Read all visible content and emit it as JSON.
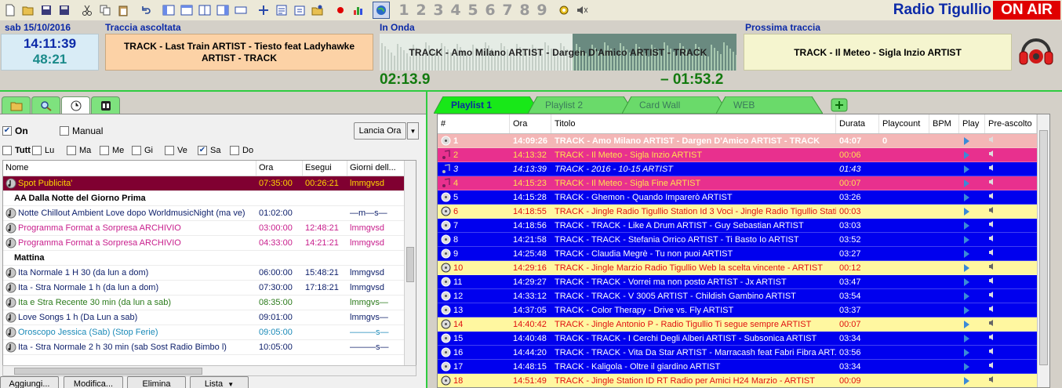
{
  "toolbar": {
    "numbers": [
      "1",
      "2",
      "3",
      "4",
      "5",
      "6",
      "7",
      "8",
      "9"
    ],
    "station": "Radio Tigullio",
    "onair": "ON AIR"
  },
  "status": {
    "date": "sab 15/10/2016",
    "time": "14:11:39",
    "sub_time": "48:21",
    "last_label": "Traccia ascoltata",
    "last_track": "TRACK - Last Train ARTIST - Tiesto feat Ladyhawke ARTIST - TRACK",
    "onda_label": "In Onda",
    "onda_track": "TRACK - Amo Milano ARTIST - Dargen D'Amico  ARTIST - TRACK",
    "elapsed": "02:13.9",
    "remaining": "– 01:53.2",
    "onda_progress": 0.54,
    "next_label": "Prossima traccia",
    "next_track": "TRACK - Il Meteo - Sigla Inzio  ARTIST"
  },
  "left": {
    "on_label": "On",
    "manual_label": "Manual",
    "lancia_label": "Lancia Ora",
    "days": [
      "Tutt",
      "Lu",
      "Ma",
      "Me",
      "Gi",
      "Ve",
      "Sa",
      "Do"
    ],
    "headers": [
      "Nome",
      "Ora",
      "Esegui",
      "Giorni dell..."
    ],
    "rows": [
      {
        "type": "sel",
        "name": "Spot Publicita'",
        "ora": "07:35:00",
        "esegui": "00:26:21",
        "giorni": "lmmgvsd"
      },
      {
        "type": "group",
        "name": "AA Dalla Notte del Giorno Prima",
        "ora": "",
        "esegui": "",
        "giorni": ""
      },
      {
        "type": "navy",
        "name": "Notte Chillout Ambient Love dopo WorldmusicNight  (ma ve)",
        "ora": "01:02:00",
        "esegui": "",
        "giorni": "—m—s—"
      },
      {
        "type": "magenta",
        "name": "Programma Format a Sorpresa ARCHIVIO",
        "ora": "03:00:00",
        "esegui": "12:48:21",
        "giorni": "lmmgvsd"
      },
      {
        "type": "magenta",
        "name": "Programma Format a Sorpresa ARCHIVIO",
        "ora": "04:33:00",
        "esegui": "14:21:21",
        "giorni": "lmmgvsd"
      },
      {
        "type": "group",
        "name": "Mattina",
        "ora": "",
        "esegui": "",
        "giorni": ""
      },
      {
        "type": "navy",
        "name": "Ita  Normale 1 H  30 (da lun a dom)",
        "ora": "06:00:00",
        "esegui": "15:48:21",
        "giorni": "lmmgvsd"
      },
      {
        "type": "navy",
        "name": "Ita - Stra Normale 1 h (da lun a dom)",
        "ora": "07:30:00",
        "esegui": "17:18:21",
        "giorni": "lmmgvsd"
      },
      {
        "type": "green",
        "name": "Ita e Stra Recente  30 min (da lun a sab)",
        "ora": "08:35:00",
        "esegui": "",
        "giorni": "lmmgvs—"
      },
      {
        "type": "navy",
        "name": "Love Songs  1 h (Da Lun a sab)",
        "ora": "09:01:00",
        "esegui": "",
        "giorni": "lmmgvs—"
      },
      {
        "type": "teal",
        "name": "Oroscopo Jessica (Sab) (Stop Ferie)",
        "ora": "09:05:00",
        "esegui": "",
        "giorni": "———s—"
      },
      {
        "type": "navy",
        "name": "Ita - Stra Normale  2 h 30 min  (sab Sost Radio Bimbo l)",
        "ora": "10:05:00",
        "esegui": "",
        "giorni": "———s—"
      }
    ],
    "buttons": [
      "Aggiungi...",
      "Modifica...",
      "Elimina",
      "Lista"
    ]
  },
  "right": {
    "tabs": [
      "Playlist 1",
      "Playlist 2",
      "Card Wall",
      "WEB"
    ],
    "headers": [
      "#",
      "Ora",
      "Titolo",
      "Durata",
      "Playcount",
      "BPM",
      "Play",
      "Pre-ascolto"
    ],
    "rows": [
      {
        "style": "first",
        "num": "1",
        "ora": "14:09:26",
        "titolo": "TRACK - Amo Milano ARTIST - Dargen D'Amico  ARTIST - TRACK",
        "durata": "04:07",
        "pc": "0"
      },
      {
        "style": "pink",
        "num": "2",
        "ora": "14:13:32",
        "titolo": "TRACK - Il Meteo - Sigla Inzio  ARTIST",
        "durata": "00:06",
        "pc": ""
      },
      {
        "style": "blue italic",
        "num": "3",
        "ora": "14:13:39",
        "titolo": "TRACK - 2016 - 10-15  ARTIST",
        "durata": "01:43",
        "pc": ""
      },
      {
        "style": "pink",
        "num": "4",
        "ora": "14:15:23",
        "titolo": "TRACK - Il Meteo - Sigla Fine  ARTIST",
        "durata": "00:07",
        "pc": ""
      },
      {
        "style": "blue",
        "num": "5",
        "ora": "14:15:28",
        "titolo": "TRACK - Ghemon - Quando Imparerò  ARTIST",
        "durata": "03:26",
        "pc": ""
      },
      {
        "style": "yellow",
        "num": "6",
        "ora": "14:18:55",
        "titolo": "TRACK - Jingle Radio Tigullio Station Id 3 Voci - Jingle Radio Tigullio Stati...",
        "durata": "00:03",
        "pc": ""
      },
      {
        "style": "blue",
        "num": "7",
        "ora": "14:18:56",
        "titolo": "TRACK - TRACK - Like A Drum ARTIST - Guy Sebastian  ARTIST",
        "durata": "03:03",
        "pc": ""
      },
      {
        "style": "blue",
        "num": "8",
        "ora": "14:21:58",
        "titolo": "TRACK - TRACK - Stefania Orrico ARTIST - Ti Basto Io  ARTIST",
        "durata": "03:52",
        "pc": ""
      },
      {
        "style": "blue",
        "num": "9",
        "ora": "14:25:48",
        "titolo": "TRACK - Claudia Megrè - Tu non puoi  ARTIST",
        "durata": "03:27",
        "pc": ""
      },
      {
        "style": "yellow",
        "num": "10",
        "ora": "14:29:16",
        "titolo": "TRACK - Jingle Marzio Radio Tigullio Web la scelta vincente -  ARTIST",
        "durata": "00:12",
        "pc": ""
      },
      {
        "style": "blue",
        "num": "11",
        "ora": "14:29:27",
        "titolo": "TRACK - TRACK - Vorrei ma non posto ARTIST - Jx  ARTIST",
        "durata": "03:47",
        "pc": ""
      },
      {
        "style": "blue",
        "num": "12",
        "ora": "14:33:12",
        "titolo": "TRACK - TRACK - V 3005 ARTIST - Childish Gambino  ARTIST",
        "durata": "03:54",
        "pc": ""
      },
      {
        "style": "blue",
        "num": "13",
        "ora": "14:37:05",
        "titolo": "TRACK - Color Therapy - Drive vs. Fly  ARTIST",
        "durata": "03:37",
        "pc": ""
      },
      {
        "style": "yellow",
        "num": "14",
        "ora": "14:40:42",
        "titolo": "TRACK - Jingle Antonio P - Radio Tigullio Ti segue sempre  ARTIST",
        "durata": "00:07",
        "pc": ""
      },
      {
        "style": "blue",
        "num": "15",
        "ora": "14:40:48",
        "titolo": "TRACK - TRACK - I Cerchi Degli Alberi ARTIST - Subsonica  ARTIST",
        "durata": "03:34",
        "pc": ""
      },
      {
        "style": "blue",
        "num": "16",
        "ora": "14:44:20",
        "titolo": "TRACK - TRACK - Vita Da Star ARTIST - Marracash feat Fabri Fibra  ART...",
        "durata": "03:56",
        "pc": ""
      },
      {
        "style": "blue",
        "num": "17",
        "ora": "14:48:15",
        "titolo": "TRACK - Kaligola - Oltre il giardino  ARTIST",
        "durata": "03:34",
        "pc": ""
      },
      {
        "style": "yellow",
        "num": "18",
        "ora": "14:51:49",
        "titolo": "TRACK - Jingle Station ID RT Radio per Amici H24 Marzio -  ARTIST",
        "durata": "00:09",
        "pc": ""
      }
    ]
  }
}
